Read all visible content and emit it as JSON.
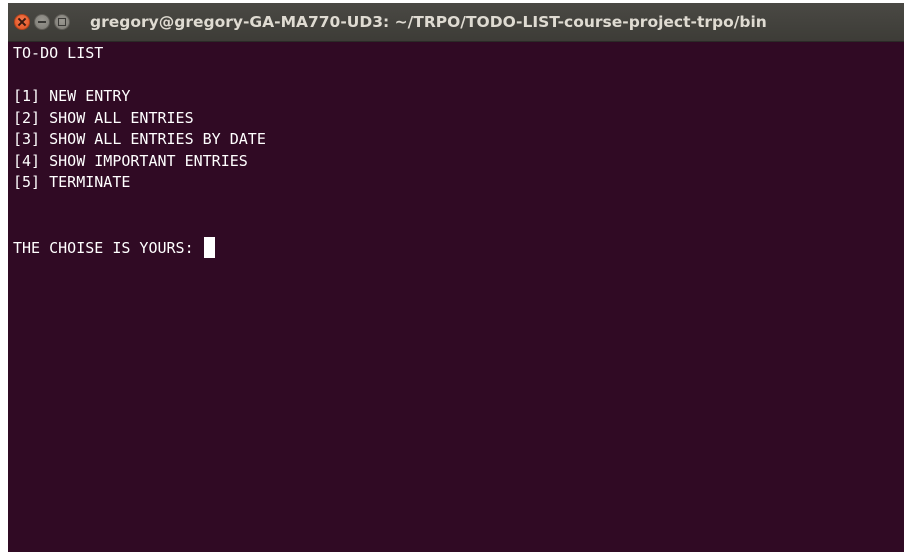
{
  "window": {
    "title": "gregory@gregory-GA-MA770-UD3: ~/TRPO/TODO-LIST-course-project-trpo/bin",
    "buttons": [
      "close-icon",
      "minimize-icon",
      "maximize-icon"
    ]
  },
  "terminal": {
    "header": "TO-DO LIST",
    "menu": [
      "[1] NEW ENTRY",
      "[2] SHOW ALL ENTRIES",
      "[3] SHOW ALL ENTRIES BY DATE",
      "[4] SHOW IMPORTANT ENTRIES",
      "[5] TERMINATE"
    ],
    "prompt": "THE CHOISE IS YOURS: ",
    "colors": {
      "background": "#300a24",
      "text": "#ffffff",
      "titlebar": "#3d3c37",
      "close_button": "#e95420"
    }
  }
}
